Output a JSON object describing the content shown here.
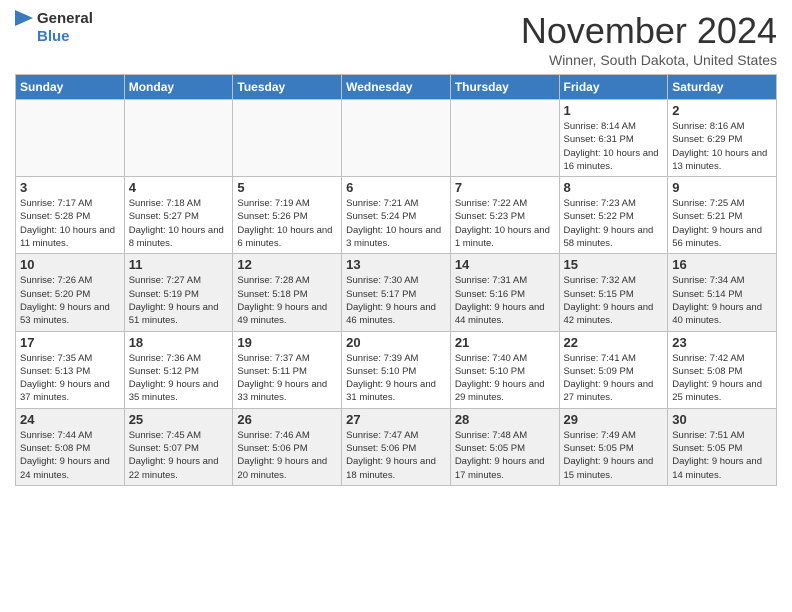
{
  "header": {
    "logo_general": "General",
    "logo_blue": "Blue",
    "month_title": "November 2024",
    "location": "Winner, South Dakota, United States"
  },
  "weekdays": [
    "Sunday",
    "Monday",
    "Tuesday",
    "Wednesday",
    "Thursday",
    "Friday",
    "Saturday"
  ],
  "weeks": [
    [
      {
        "day": "",
        "info": "",
        "empty": true
      },
      {
        "day": "",
        "info": "",
        "empty": true
      },
      {
        "day": "",
        "info": "",
        "empty": true
      },
      {
        "day": "",
        "info": "",
        "empty": true
      },
      {
        "day": "",
        "info": "",
        "empty": true
      },
      {
        "day": "1",
        "info": "Sunrise: 8:14 AM\nSunset: 6:31 PM\nDaylight: 10 hours and 16 minutes.",
        "empty": false
      },
      {
        "day": "2",
        "info": "Sunrise: 8:16 AM\nSunset: 6:29 PM\nDaylight: 10 hours and 13 minutes.",
        "empty": false
      }
    ],
    [
      {
        "day": "3",
        "info": "Sunrise: 7:17 AM\nSunset: 5:28 PM\nDaylight: 10 hours and 11 minutes.",
        "empty": false
      },
      {
        "day": "4",
        "info": "Sunrise: 7:18 AM\nSunset: 5:27 PM\nDaylight: 10 hours and 8 minutes.",
        "empty": false
      },
      {
        "day": "5",
        "info": "Sunrise: 7:19 AM\nSunset: 5:26 PM\nDaylight: 10 hours and 6 minutes.",
        "empty": false
      },
      {
        "day": "6",
        "info": "Sunrise: 7:21 AM\nSunset: 5:24 PM\nDaylight: 10 hours and 3 minutes.",
        "empty": false
      },
      {
        "day": "7",
        "info": "Sunrise: 7:22 AM\nSunset: 5:23 PM\nDaylight: 10 hours and 1 minute.",
        "empty": false
      },
      {
        "day": "8",
        "info": "Sunrise: 7:23 AM\nSunset: 5:22 PM\nDaylight: 9 hours and 58 minutes.",
        "empty": false
      },
      {
        "day": "9",
        "info": "Sunrise: 7:25 AM\nSunset: 5:21 PM\nDaylight: 9 hours and 56 minutes.",
        "empty": false
      }
    ],
    [
      {
        "day": "10",
        "info": "Sunrise: 7:26 AM\nSunset: 5:20 PM\nDaylight: 9 hours and 53 minutes.",
        "empty": false
      },
      {
        "day": "11",
        "info": "Sunrise: 7:27 AM\nSunset: 5:19 PM\nDaylight: 9 hours and 51 minutes.",
        "empty": false
      },
      {
        "day": "12",
        "info": "Sunrise: 7:28 AM\nSunset: 5:18 PM\nDaylight: 9 hours and 49 minutes.",
        "empty": false
      },
      {
        "day": "13",
        "info": "Sunrise: 7:30 AM\nSunset: 5:17 PM\nDaylight: 9 hours and 46 minutes.",
        "empty": false
      },
      {
        "day": "14",
        "info": "Sunrise: 7:31 AM\nSunset: 5:16 PM\nDaylight: 9 hours and 44 minutes.",
        "empty": false
      },
      {
        "day": "15",
        "info": "Sunrise: 7:32 AM\nSunset: 5:15 PM\nDaylight: 9 hours and 42 minutes.",
        "empty": false
      },
      {
        "day": "16",
        "info": "Sunrise: 7:34 AM\nSunset: 5:14 PM\nDaylight: 9 hours and 40 minutes.",
        "empty": false
      }
    ],
    [
      {
        "day": "17",
        "info": "Sunrise: 7:35 AM\nSunset: 5:13 PM\nDaylight: 9 hours and 37 minutes.",
        "empty": false
      },
      {
        "day": "18",
        "info": "Sunrise: 7:36 AM\nSunset: 5:12 PM\nDaylight: 9 hours and 35 minutes.",
        "empty": false
      },
      {
        "day": "19",
        "info": "Sunrise: 7:37 AM\nSunset: 5:11 PM\nDaylight: 9 hours and 33 minutes.",
        "empty": false
      },
      {
        "day": "20",
        "info": "Sunrise: 7:39 AM\nSunset: 5:10 PM\nDaylight: 9 hours and 31 minutes.",
        "empty": false
      },
      {
        "day": "21",
        "info": "Sunrise: 7:40 AM\nSunset: 5:10 PM\nDaylight: 9 hours and 29 minutes.",
        "empty": false
      },
      {
        "day": "22",
        "info": "Sunrise: 7:41 AM\nSunset: 5:09 PM\nDaylight: 9 hours and 27 minutes.",
        "empty": false
      },
      {
        "day": "23",
        "info": "Sunrise: 7:42 AM\nSunset: 5:08 PM\nDaylight: 9 hours and 25 minutes.",
        "empty": false
      }
    ],
    [
      {
        "day": "24",
        "info": "Sunrise: 7:44 AM\nSunset: 5:08 PM\nDaylight: 9 hours and 24 minutes.",
        "empty": false
      },
      {
        "day": "25",
        "info": "Sunrise: 7:45 AM\nSunset: 5:07 PM\nDaylight: 9 hours and 22 minutes.",
        "empty": false
      },
      {
        "day": "26",
        "info": "Sunrise: 7:46 AM\nSunset: 5:06 PM\nDaylight: 9 hours and 20 minutes.",
        "empty": false
      },
      {
        "day": "27",
        "info": "Sunrise: 7:47 AM\nSunset: 5:06 PM\nDaylight: 9 hours and 18 minutes.",
        "empty": false
      },
      {
        "day": "28",
        "info": "Sunrise: 7:48 AM\nSunset: 5:05 PM\nDaylight: 9 hours and 17 minutes.",
        "empty": false
      },
      {
        "day": "29",
        "info": "Sunrise: 7:49 AM\nSunset: 5:05 PM\nDaylight: 9 hours and 15 minutes.",
        "empty": false
      },
      {
        "day": "30",
        "info": "Sunrise: 7:51 AM\nSunset: 5:05 PM\nDaylight: 9 hours and 14 minutes.",
        "empty": false
      }
    ]
  ]
}
